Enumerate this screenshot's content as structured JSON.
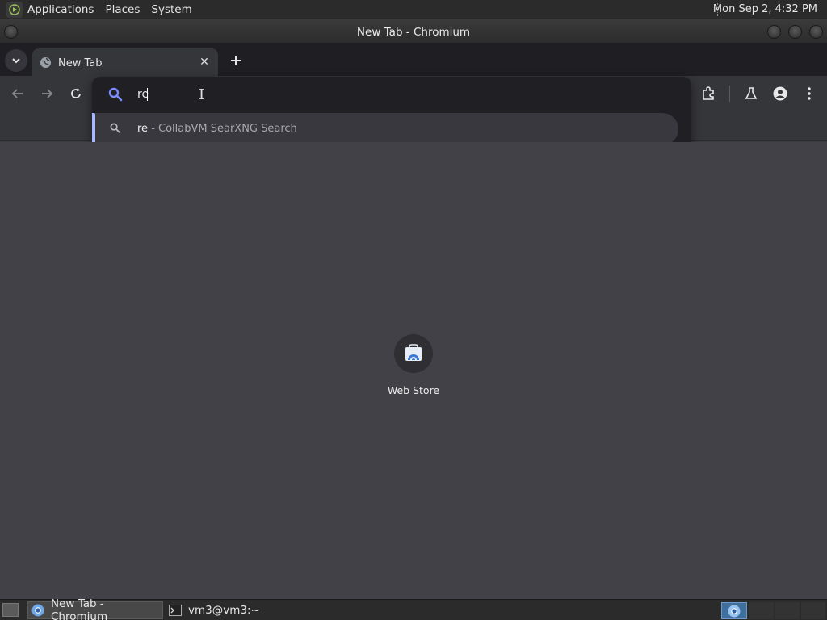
{
  "top_panel": {
    "menus": [
      "Applications",
      "Places",
      "System"
    ],
    "clock": "Mon Sep  2,  4:32 PM"
  },
  "window": {
    "title": "New Tab - Chromium"
  },
  "tabs": [
    {
      "title": "New Tab",
      "active": true
    }
  ],
  "omnibox": {
    "input_value": "re",
    "suggestions": [
      {
        "query": "re",
        "description": " - CollabVM SearXNG Search"
      }
    ]
  },
  "shortcuts": [
    {
      "label": "Web Store"
    }
  ],
  "taskbar": {
    "tasks": [
      {
        "label": "New Tab - Chromium",
        "active": true
      },
      {
        "label": "vm3@vm3:~",
        "active": false
      }
    ]
  },
  "colors": {
    "accent": "#a8b8ff",
    "search_icon": "#7b8cff",
    "content_bg": "#414147"
  }
}
